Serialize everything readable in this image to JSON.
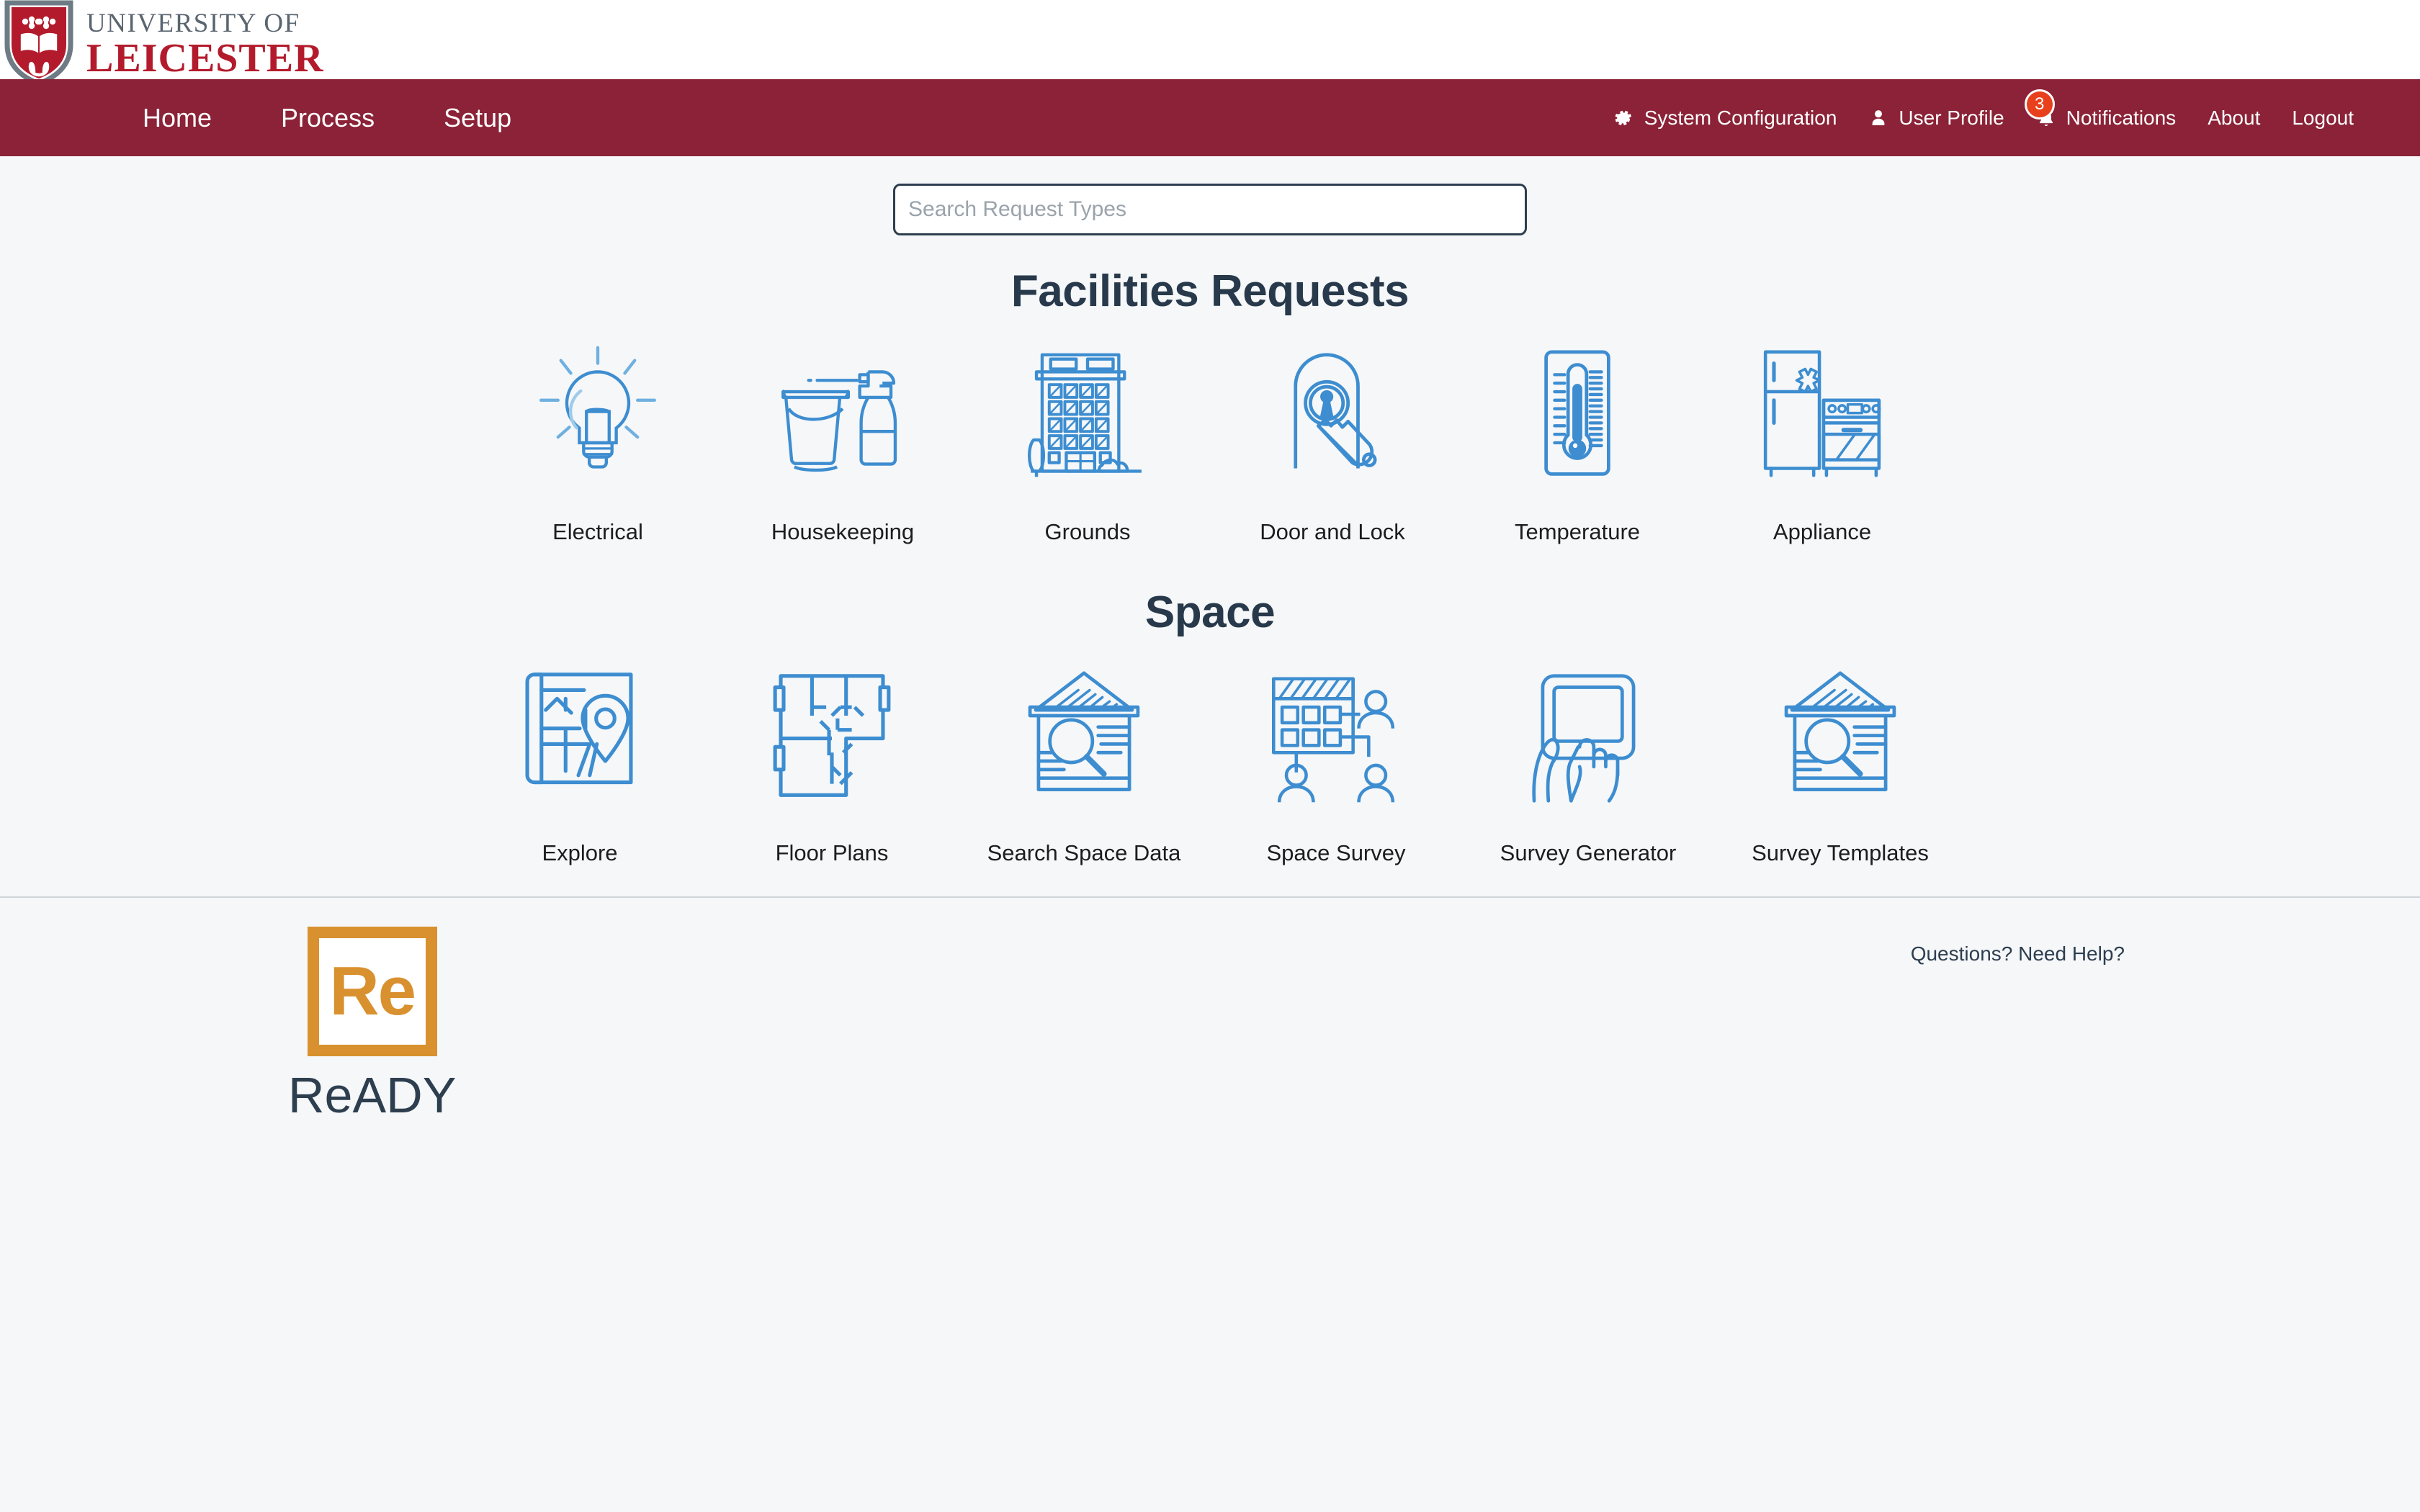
{
  "brand": {
    "university_line1": "UNIVERSITY OF",
    "university_line2": "LEICESTER",
    "crest_icon": "university-crest-icon",
    "maroon": "#8b2237",
    "crest_red": "#b31b2c",
    "accent_blue": "#3d8dd0",
    "heading_navy": "#27394a",
    "ready_orange": "#d9912f",
    "badge_red": "#e8401c",
    "page_background": "#f5f7f9"
  },
  "navbar": {
    "primary": [
      {
        "label": "Home",
        "name": "nav-home"
      },
      {
        "label": "Process",
        "name": "nav-process"
      },
      {
        "label": "Setup",
        "name": "nav-setup"
      }
    ],
    "secondary": [
      {
        "label": "System Configuration",
        "icon": "gear-icon"
      },
      {
        "label": "User Profile",
        "icon": "user-icon"
      },
      {
        "label": "Notifications",
        "icon": "bell-icon",
        "badge": "3"
      },
      {
        "label": "About",
        "icon": null
      },
      {
        "label": "Logout",
        "icon": null
      }
    ]
  },
  "search": {
    "placeholder": "Search Request Types",
    "value": ""
  },
  "sections": [
    {
      "title": "Facilities Requests",
      "tiles": [
        {
          "label": "Electrical",
          "icon": "lightbulb-icon"
        },
        {
          "label": "Housekeeping",
          "icon": "bucket-spray-bottle-icon"
        },
        {
          "label": "Grounds",
          "icon": "building-grounds-icon"
        },
        {
          "label": "Door and Lock",
          "icon": "door-key-lock-icon"
        },
        {
          "label": "Temperature",
          "icon": "thermometer-icon"
        },
        {
          "label": "Appliance",
          "icon": "fridge-stove-icon"
        }
      ]
    },
    {
      "title": "Space",
      "tiles": [
        {
          "label": "Explore",
          "icon": "map-pin-icon"
        },
        {
          "label": "Floor Plans",
          "icon": "floor-plan-icon"
        },
        {
          "label": "Search Space Data",
          "icon": "house-magnifier-icon"
        },
        {
          "label": "Space Survey",
          "icon": "building-people-icon"
        },
        {
          "label": "Survey Generator",
          "icon": "hand-tablet-icon"
        },
        {
          "label": "Survey Templates",
          "icon": "house-magnifier-icon"
        }
      ]
    }
  ],
  "footer": {
    "logo_mark": "Re",
    "logo_word": "ReADY",
    "help_text": "Questions? Need Help?"
  }
}
